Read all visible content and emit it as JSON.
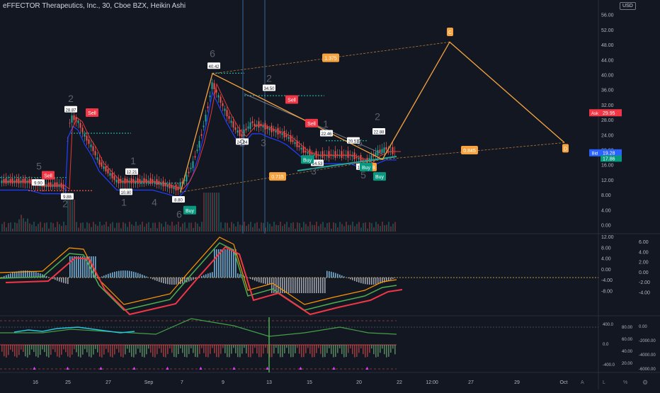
{
  "header": {
    "symbol_title": "eFFECTOR Therapeutics, Inc., 30, Cboe BZX, Heikin Ashi",
    "currency": "USD"
  },
  "price_axis": {
    "ticks": [
      "56.00",
      "52.00",
      "48.00",
      "44.00",
      "40.00",
      "36.00",
      "32.00",
      "28.00",
      "24.00",
      "20.00",
      "16.00",
      "12.00",
      "8.00",
      "4.00",
      "0.00"
    ],
    "ask_label": "Ask",
    "ask_value": "29.95",
    "bid_label": "Bid",
    "bid_value": "19.28",
    "last_value": "17.86"
  },
  "osc1_axis": {
    "left_ticks": [
      "12.00",
      "8.00",
      "4.00",
      "0.00",
      "-4.00",
      "-8.00"
    ],
    "right_ticks": [
      "6.00",
      "4.00",
      "2.00",
      "0.00",
      "-2.00",
      "-4.00"
    ]
  },
  "osc2_axis": {
    "left_ticks": [
      "400.0",
      "0.0",
      "-400.0"
    ],
    "mid_ticks": [
      "80.00",
      "60.00",
      "40.00",
      "20.00"
    ],
    "right_ticks": [
      "0.00",
      "-2000.00",
      "-4000.00",
      "-6000.00"
    ]
  },
  "time_axis": {
    "labels": [
      "16",
      "25",
      "27",
      "Sep",
      "7",
      "9",
      "13",
      "15",
      "20",
      "22",
      "12:00",
      "27",
      "29",
      "Oct"
    ]
  },
  "chart_data": {
    "type": "candlestick",
    "title": "eFFECTOR Therapeutics, Inc., 30, Cboe BZX, Heikin Ashi",
    "price_range": [
      0,
      56
    ],
    "price_labels": [
      "9.90",
      "9.88",
      "28.87",
      "12.21",
      "10.80",
      "8.80",
      "40.42",
      "34.50",
      "24.24",
      "22.46",
      "20.51",
      "17.50",
      "22.88",
      "14.53"
    ],
    "signals": [
      "Sell",
      "Sell",
      "Sell",
      "Sell",
      "Buy",
      "Buy",
      "Buy",
      "Buy"
    ],
    "wave_counts": [
      "5",
      "2",
      "2",
      "1",
      "4",
      "1",
      "6",
      "6",
      "2",
      "3",
      "2",
      "1",
      "3",
      "2",
      "5",
      "5"
    ],
    "harmonic_ratios": [
      "1.375",
      "0.715",
      "0.845"
    ],
    "pattern_points": [
      "C",
      "D",
      "B"
    ]
  },
  "icons": {
    "axis_buttons": [
      "A",
      "L",
      "%",
      "⚙"
    ]
  }
}
